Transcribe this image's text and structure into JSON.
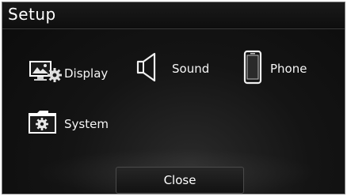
{
  "header": {
    "title": "Setup"
  },
  "menu": {
    "items": [
      {
        "label": "Display",
        "icon": "display-settings-icon"
      },
      {
        "label": "Sound",
        "icon": "speaker-icon"
      },
      {
        "label": "Phone",
        "icon": "phone-icon"
      },
      {
        "label": "System",
        "icon": "system-settings-folder-icon"
      }
    ]
  },
  "footer": {
    "close_label": "Close"
  },
  "colors": {
    "background": "#0b0b0b",
    "text": "#ffffff",
    "border": "#7a7a7a"
  }
}
